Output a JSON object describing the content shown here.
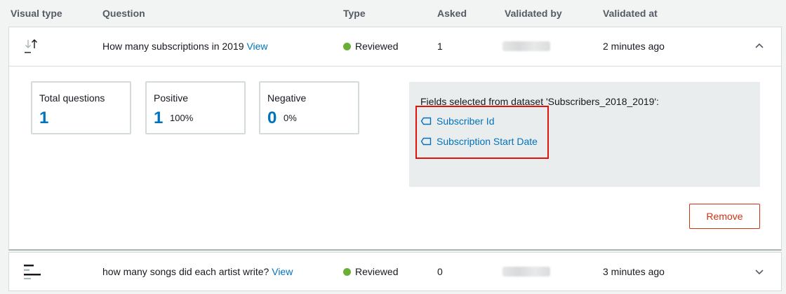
{
  "columns": {
    "visual_type": "Visual type",
    "question": "Question",
    "type": "Type",
    "asked": "Asked",
    "validated_by": "Validated by",
    "validated_at": "Validated at"
  },
  "rows": [
    {
      "visual_icon": "sort-arrows-icon",
      "question": "How many subscriptions in 2019",
      "view_link": "View",
      "type": "Reviewed",
      "asked": "1",
      "validated_at": "2 minutes ago",
      "expanded": true,
      "stats": [
        {
          "title": "Total questions",
          "value": "1",
          "percent": ""
        },
        {
          "title": "Positive",
          "value": "1",
          "percent": "100%"
        },
        {
          "title": "Negative",
          "value": "0",
          "percent": "0%"
        }
      ],
      "fields_title": "Fields selected from dataset 'Subscribers_2018_2019':",
      "fields": [
        "Subscriber Id",
        "Subscription Start Date"
      ],
      "remove_label": "Remove"
    },
    {
      "visual_icon": "horizontal-bar-chart-icon",
      "question": "how many songs did each artist write?",
      "view_link": "View",
      "type": "Reviewed",
      "asked": "0",
      "validated_at": "3 minutes ago",
      "expanded": false
    }
  ],
  "colors": {
    "link": "#0073bb",
    "status_reviewed": "#6aaf35",
    "remove": "#d13212",
    "highlight": "#e3120b"
  }
}
